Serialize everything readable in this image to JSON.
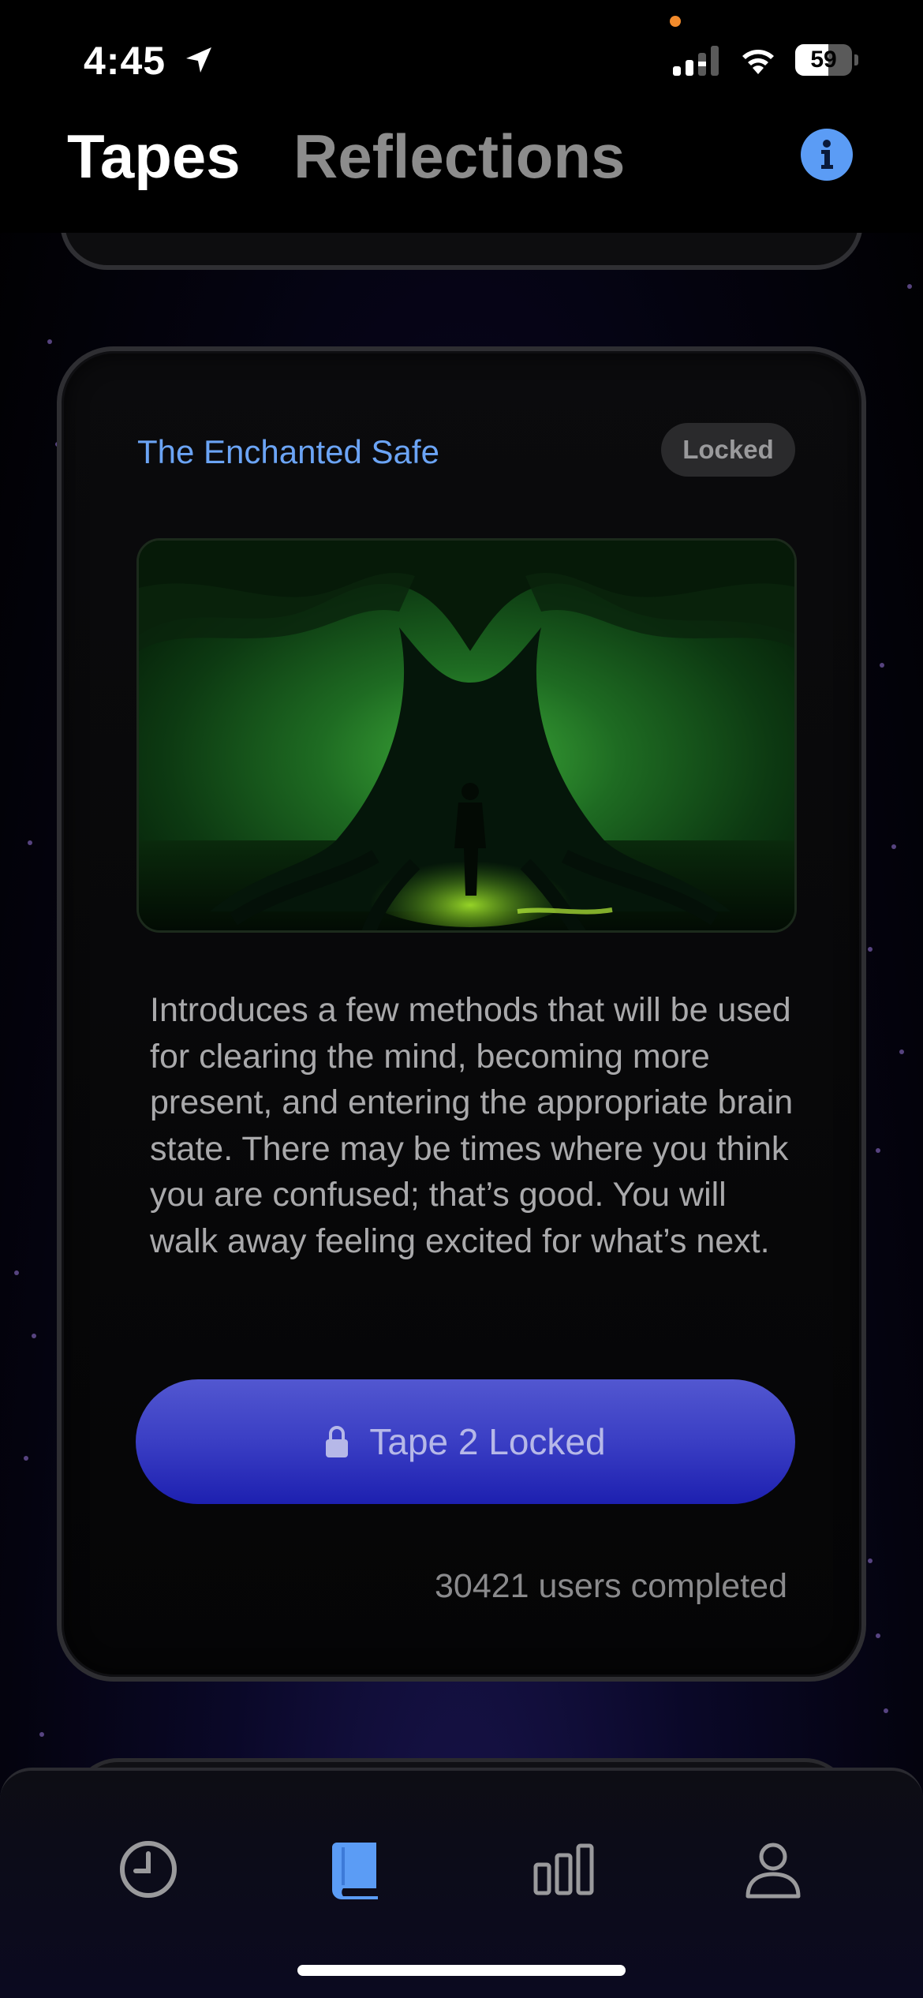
{
  "status_bar": {
    "time": "4:45",
    "battery_level": "59",
    "battery_fraction": 0.59
  },
  "header": {
    "tabs": [
      {
        "label": "Tapes",
        "active": true
      },
      {
        "label": "Reflections",
        "active": false
      }
    ],
    "info_icon": "info-icon"
  },
  "card": {
    "title": "The Enchanted Safe",
    "badge": "Locked",
    "image_subject": "tree-silhouette-image",
    "description": "Introduces a few methods that will be used for clearing the mind, becoming more present, and entering the appropriate brain state.  There may be times where you think you are confused; that’s good. You will walk away feeling excited for what’s next.",
    "button_label": "Tape 2 Locked",
    "users_completed": "30421 users completed"
  },
  "tab_bar": {
    "items": [
      {
        "icon": "history-clock-icon",
        "active": false
      },
      {
        "icon": "book-icon",
        "active": true
      },
      {
        "icon": "bar-chart-icon",
        "active": false
      },
      {
        "icon": "profile-icon",
        "active": false
      }
    ]
  },
  "colors": {
    "accent_blue": "#5b9cf5",
    "title_blue": "#6ba4f5",
    "button_gradient_top": "#5257d0",
    "button_gradient_bottom": "#1d20b0",
    "inactive_tab": "#8c8c8c"
  }
}
